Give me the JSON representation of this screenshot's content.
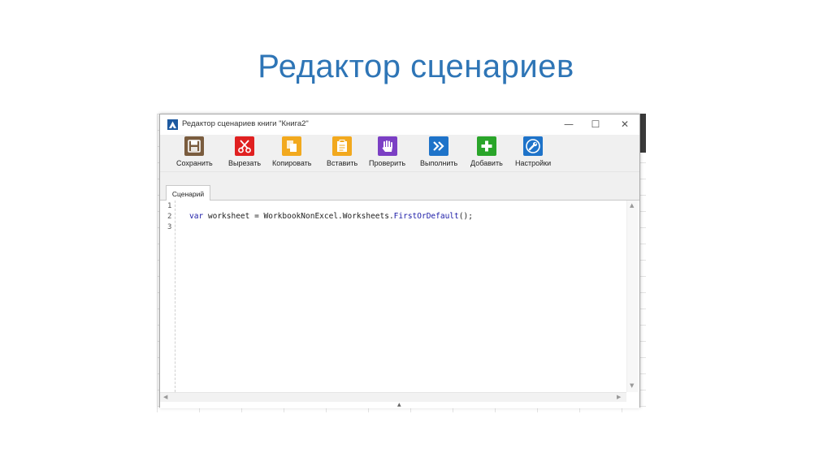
{
  "slide": {
    "title": "Редактор сценариев"
  },
  "window": {
    "title": "Редактор сценариев книги \"Книга2\"",
    "controls": {
      "minimize": "—",
      "maximize": "☐",
      "close": "✕"
    }
  },
  "toolbar": {
    "buttons": [
      {
        "label": "Сохранить",
        "icon": "save-icon",
        "color": "#7a5c3e"
      },
      {
        "label": "Вырезать",
        "icon": "scissors-icon",
        "color": "#e02020"
      },
      {
        "label": "Копировать",
        "icon": "copy-icon",
        "color": "#f2a91e"
      },
      {
        "label": "Вставить",
        "icon": "paste-icon",
        "color": "#f2a91e"
      },
      {
        "label": "Проверить",
        "icon": "hand-icon",
        "color": "#7b3fc4"
      },
      {
        "label": "Выполнить",
        "icon": "fast-forward-icon",
        "color": "#1e73c9"
      },
      {
        "label": "Добавить",
        "icon": "plus-icon",
        "color": "#2aa52a"
      },
      {
        "label": "Настройки",
        "icon": "wrench-icon",
        "color": "#1e73c9"
      }
    ]
  },
  "tabs": [
    {
      "label": "Сценарий"
    }
  ],
  "editor": {
    "line_numbers": [
      "1",
      "2",
      "3"
    ],
    "code": {
      "keyword": "var",
      "part1": " worksheet = WorkbookNonExcel.Worksheets.",
      "method": "FirstOrDefault",
      "part2": "();"
    }
  }
}
